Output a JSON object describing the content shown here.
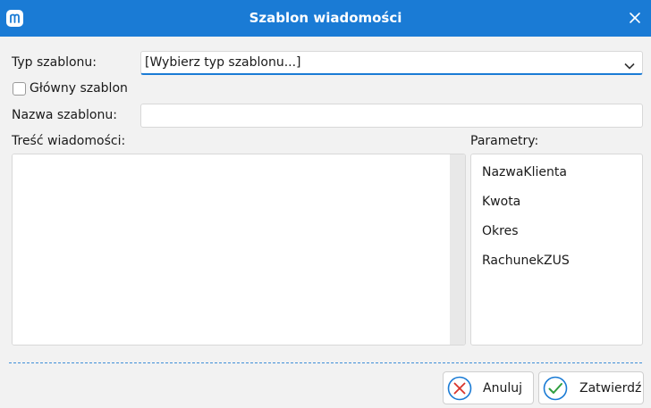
{
  "window": {
    "title": "Szablon wiadomości",
    "accent_color": "#1a7bd5",
    "icons": {
      "app": "app-logo-icon",
      "close": "close-icon"
    }
  },
  "form": {
    "template_type": {
      "label": "Typ szablonu:",
      "selected_value": "[Wybierz typ szablonu...]"
    },
    "main_template": {
      "label": "Główny szablon",
      "checked": false
    },
    "template_name": {
      "label": "Nazwa szablonu:",
      "value": ""
    },
    "message_body": {
      "label": "Treść wiadomości:",
      "value": ""
    },
    "parameters": {
      "label": "Parametry:",
      "items": [
        "NazwaKlienta",
        "Kwota",
        "Okres",
        "RachunekZUS"
      ]
    }
  },
  "buttons": {
    "cancel": {
      "label": "Anuluj",
      "icon": "cancel-x-icon",
      "icon_color": "#d9342b"
    },
    "confirm": {
      "label": "Zatwierdź",
      "icon": "confirm-check-icon",
      "icon_color": "#2e9e3e"
    }
  }
}
